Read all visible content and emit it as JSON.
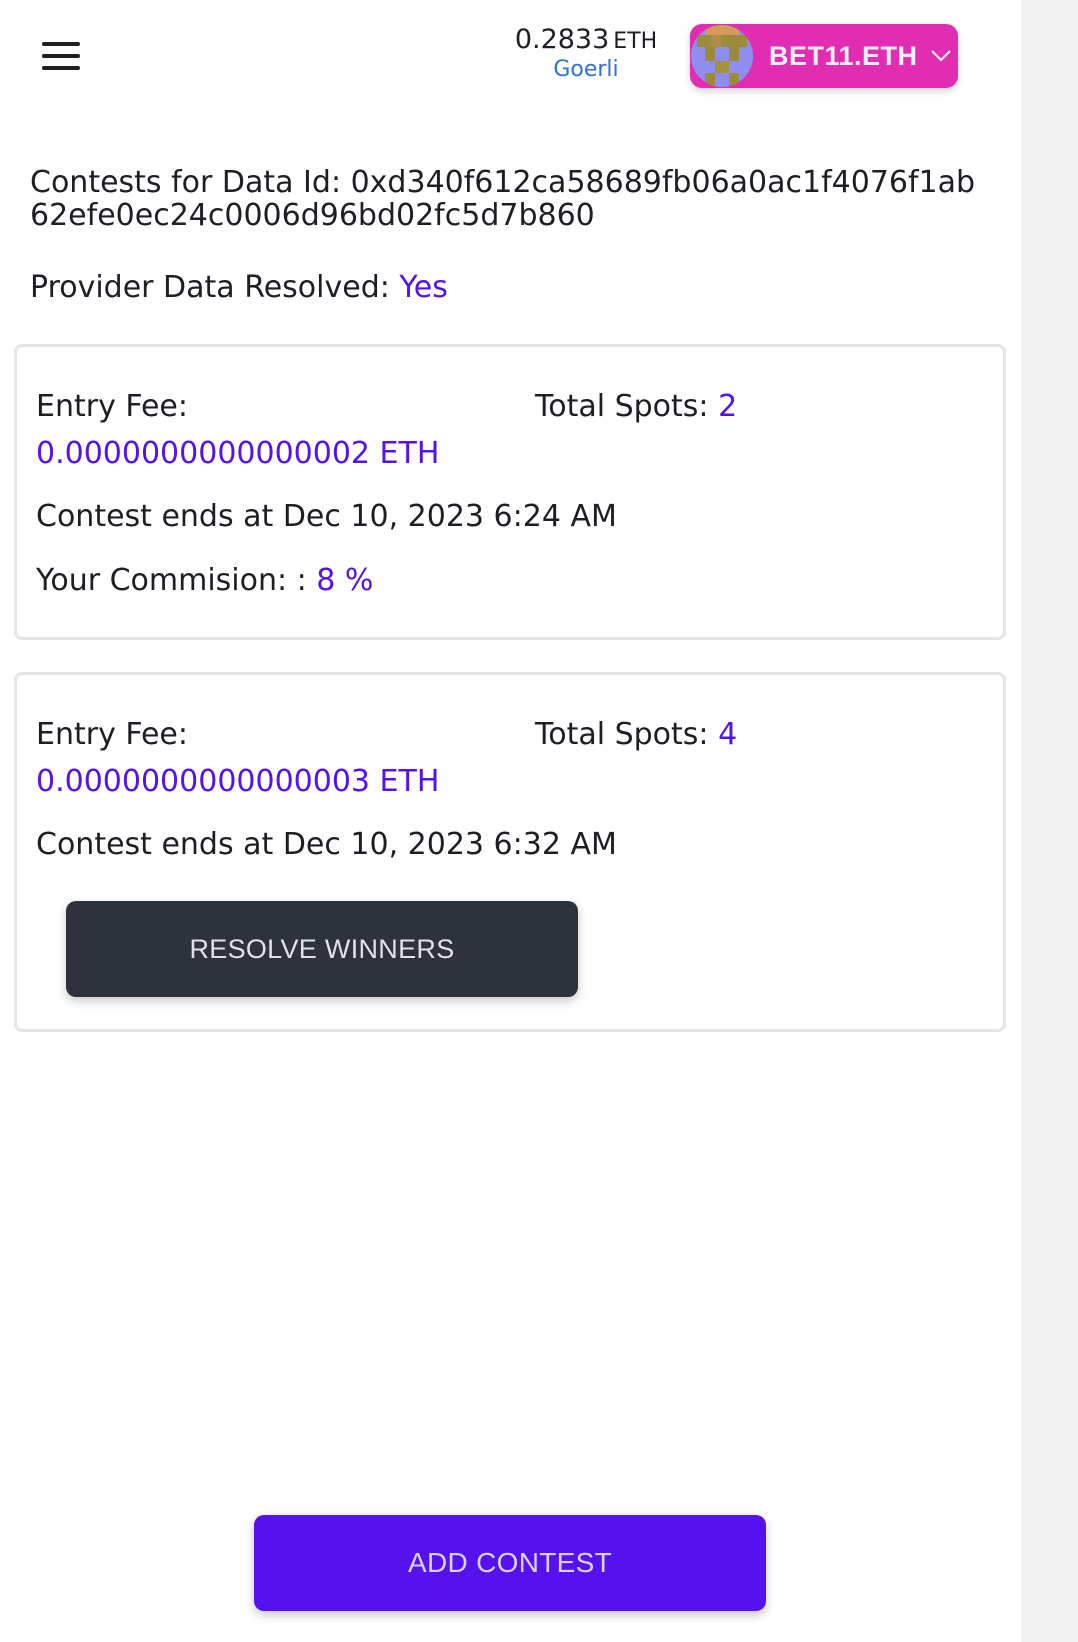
{
  "header": {
    "menu_icon": "hamburger-menu-icon",
    "balance_amount": "0.2833",
    "balance_unit": "ETH",
    "network": "Goerli",
    "account_name": "BET11.ETH",
    "account_chevron_icon": "chevron-down-icon",
    "account_color": "#e02db2"
  },
  "contests_header": {
    "label": "Contests for Data Id:",
    "data_id": "0xd340f612ca58689fb06a0ac1f4076f1ab62efe0ec24c0006d96bd02fc5d7b860"
  },
  "provider": {
    "label": "Provider Data Resolved:",
    "value": "Yes"
  },
  "contests": [
    {
      "entry_fee_label": "Entry Fee:",
      "entry_fee_value": "0.0000000000000002 ETH",
      "total_spots_label": "Total Spots:",
      "total_spots_value": "2",
      "ends_text": "Contest ends at Dec 10, 2023 6:24 AM",
      "commission_label": "Your Commision: :",
      "commission_value": "8 %"
    },
    {
      "entry_fee_label": "Entry Fee:",
      "entry_fee_value": "0.0000000000000003 ETH",
      "total_spots_label": "Total Spots:",
      "total_spots_value": "4",
      "ends_text": "Contest ends at Dec 10, 2023 6:32 AM",
      "resolve_button_label": "RESOLVE WINNERS"
    }
  ],
  "footer": {
    "add_contest_label": "ADD CONTEST"
  },
  "colors": {
    "accent": "#5413ee",
    "link": "#2f6fe0",
    "dark_button": "#2d323d"
  }
}
